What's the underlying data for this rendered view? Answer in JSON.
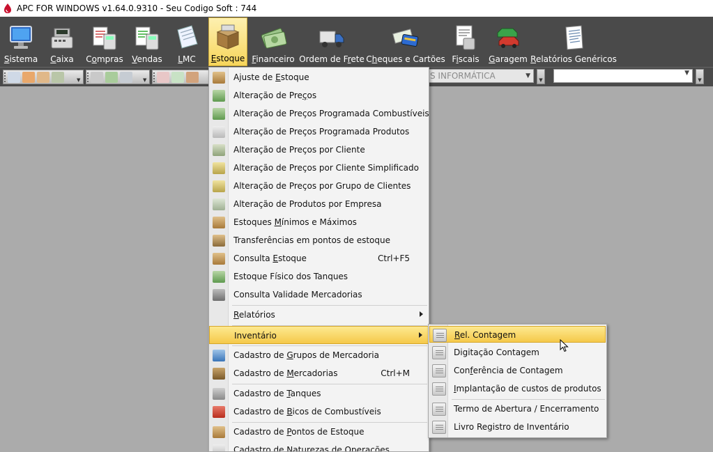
{
  "window": {
    "title": "APC FOR WINDOWS v1.64.0.9310 - Seu Codigo Soft : 744"
  },
  "ribbon": {
    "items": [
      {
        "pre": "",
        "key": "S",
        "post": "istema",
        "icon": "computer-icon"
      },
      {
        "pre": "",
        "key": "C",
        "post": "aixa",
        "icon": "cash-register-icon"
      },
      {
        "pre": "C",
        "key": "o",
        "post": "mpras",
        "icon": "purchases-icon"
      },
      {
        "pre": "",
        "key": "V",
        "post": "endas",
        "icon": "sales-icon"
      },
      {
        "pre": "",
        "key": "L",
        "post": "MC",
        "icon": "lmc-icon"
      },
      {
        "pre": "",
        "key": "E",
        "post": "stoque",
        "icon": "stock-box-icon"
      },
      {
        "pre": "",
        "key": "F",
        "post": "inanceiro",
        "icon": "money-icon"
      },
      {
        "pre": "Ordem de F",
        "key": "r",
        "post": "ete",
        "icon": "truck-icon"
      },
      {
        "pre": "C",
        "key": "h",
        "post": "eques e Cartões",
        "icon": "cheque-card-icon"
      },
      {
        "pre": "F",
        "key": "i",
        "post": "scais",
        "icon": "fiscal-icon"
      },
      {
        "pre": "",
        "key": "G",
        "post": "aragem",
        "icon": "garage-car-icon"
      },
      {
        "pre": "",
        "key": "R",
        "post": "elatórios Genéricos",
        "icon": "reports-icon"
      }
    ]
  },
  "toolbar": {
    "combo1_value": "S INFORMÁTICA",
    "combo2_value": ""
  },
  "menu": {
    "items": [
      {
        "pre": "Ajuste de ",
        "key": "E",
        "post": "stoque",
        "shortcut": ""
      },
      {
        "pre": "Alteração de Pre",
        "key": "ç",
        "post": "os",
        "shortcut": ""
      },
      {
        "pre": "Alteração de Preços Programada Combustíveis",
        "key": "",
        "post": "",
        "shortcut": ""
      },
      {
        "pre": "Alteração de Preços Programada Produtos",
        "key": "",
        "post": "",
        "shortcut": ""
      },
      {
        "pre": "Alteração de Preços por Cliente",
        "key": "",
        "post": "",
        "shortcut": ""
      },
      {
        "pre": "Alteração de Preços por Cliente Simplificado",
        "key": "",
        "post": "",
        "shortcut": ""
      },
      {
        "pre": "Alteração de Preços por Grupo de Clientes",
        "key": "",
        "post": "",
        "shortcut": ""
      },
      {
        "pre": "Alteração de Produtos por Empresa",
        "key": "",
        "post": "",
        "shortcut": ""
      },
      {
        "pre": "Estoques ",
        "key": "M",
        "post": "ínimos e Máximos",
        "shortcut": ""
      },
      {
        "pre": "Transferências em pontos de estoque",
        "key": "",
        "post": "",
        "shortcut": ""
      },
      {
        "pre": "Consulta ",
        "key": "E",
        "post": "stoque",
        "shortcut": "Ctrl+F5"
      },
      {
        "pre": "Estoque Físico dos Tanques",
        "key": "",
        "post": "",
        "shortcut": ""
      },
      {
        "pre": "Consulta Validade Mercadorias",
        "key": "",
        "post": "",
        "shortcut": ""
      },
      {
        "pre": "",
        "key": "R",
        "post": "elatórios",
        "shortcut": ""
      },
      {
        "pre": "Inventário",
        "key": "",
        "post": "",
        "shortcut": ""
      },
      {
        "pre": "Cadastro de ",
        "key": "G",
        "post": "rupos de Mercadoria",
        "shortcut": ""
      },
      {
        "pre": "Cadastro de ",
        "key": "M",
        "post": "ercadorias",
        "shortcut": "Ctrl+M"
      },
      {
        "pre": "Cadastro de ",
        "key": "T",
        "post": "anques",
        "shortcut": ""
      },
      {
        "pre": "Cadastro de ",
        "key": "B",
        "post": "icos de Combustíveis",
        "shortcut": ""
      },
      {
        "pre": "Cadastro de ",
        "key": "P",
        "post": "ontos de Estoque",
        "shortcut": ""
      },
      {
        "pre": "Cadastro de Naturezas de Operações",
        "key": "",
        "post": "",
        "shortcut": ""
      }
    ]
  },
  "submenu": {
    "items": [
      {
        "pre": "",
        "key": "R",
        "post": "el. Contagem"
      },
      {
        "pre": "Digitação Contagem",
        "key": "",
        "post": ""
      },
      {
        "pre": "Con",
        "key": "f",
        "post": "erência de Contagem"
      },
      {
        "pre": "",
        "key": "I",
        "post": "mplantação de custos de produtos"
      },
      {
        "pre": "Termo de Abertura / Encerramento",
        "key": "",
        "post": ""
      },
      {
        "pre": "Livro Registro de Inventário",
        "key": "",
        "post": ""
      }
    ]
  }
}
